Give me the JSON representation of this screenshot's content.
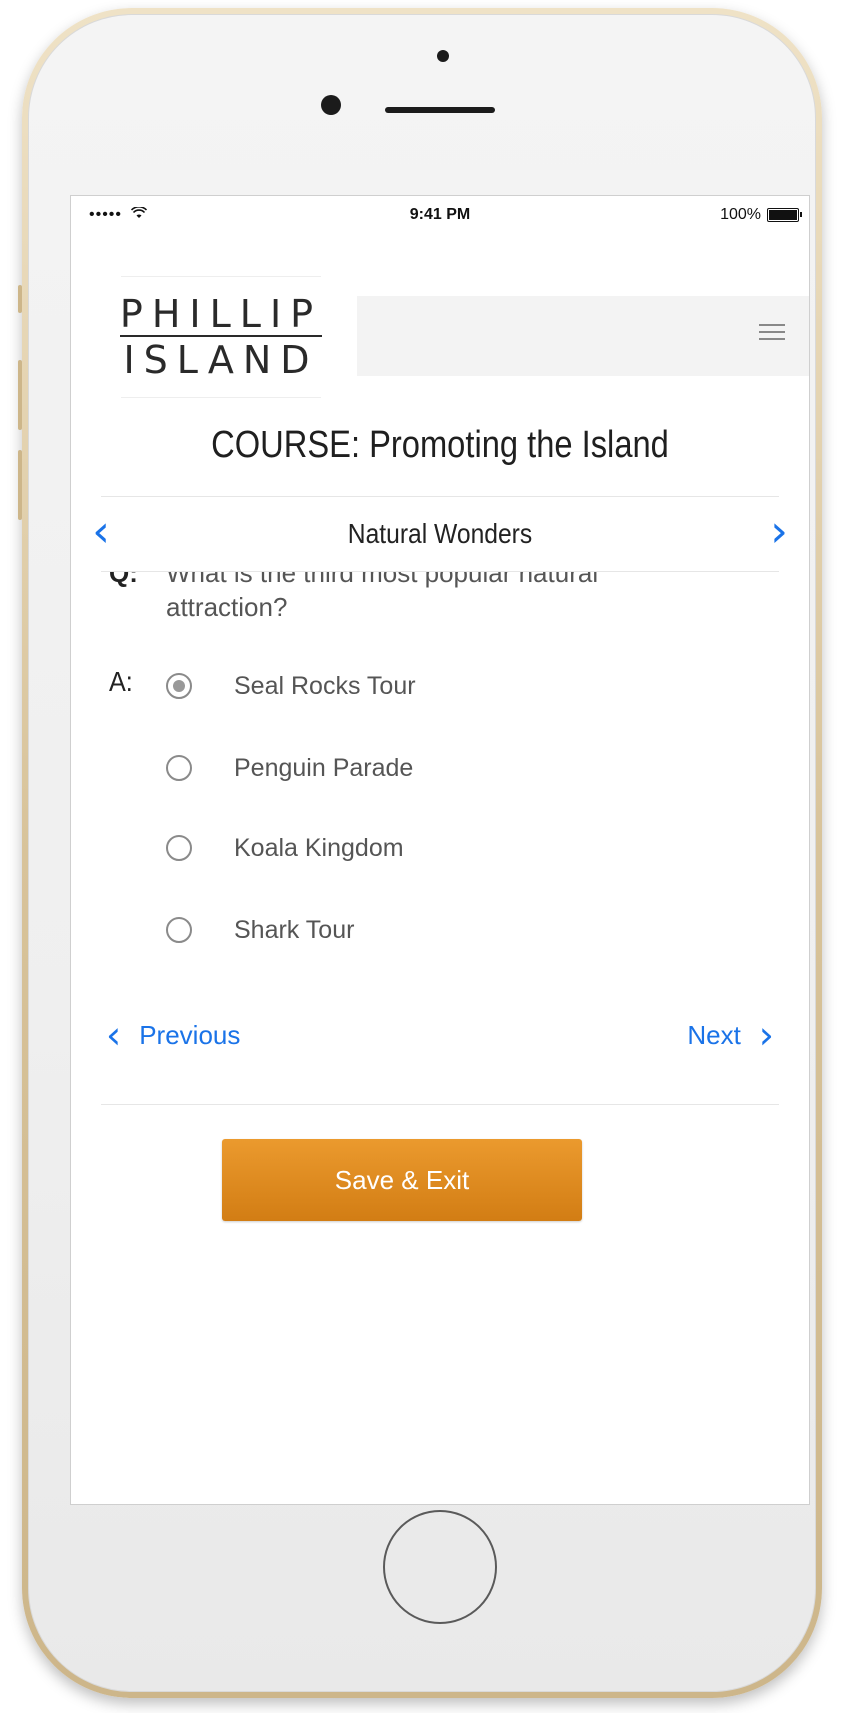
{
  "status_bar": {
    "signal": "•••••",
    "wifi": "wifi-icon",
    "time": "9:41 PM",
    "battery": "100%"
  },
  "header": {
    "logo_line1": "PHILLIP",
    "logo_line2": "ISLAND",
    "menu_icon": "hamburger-icon"
  },
  "course": {
    "title": "COURSE: Promoting the Island"
  },
  "section": {
    "title": "Natural Wonders",
    "prev_icon": "chevron-left-icon",
    "next_icon": "chevron-right-icon"
  },
  "question": {
    "q_label": "Q:",
    "text": "What is the third most popular natural attraction?"
  },
  "answer": {
    "a_label": "A:",
    "options": [
      {
        "label": "Seal Rocks Tour",
        "selected": true
      },
      {
        "label": "Penguin Parade",
        "selected": false
      },
      {
        "label": "Koala Kingdom",
        "selected": false
      },
      {
        "label": "Shark Tour",
        "selected": false
      }
    ]
  },
  "pager": {
    "previous": "Previous",
    "next": "Next"
  },
  "actions": {
    "save_exit": "Save & Exit"
  },
  "colors": {
    "accent_blue": "#1a73e8",
    "button_orange": "#e08a1f"
  }
}
